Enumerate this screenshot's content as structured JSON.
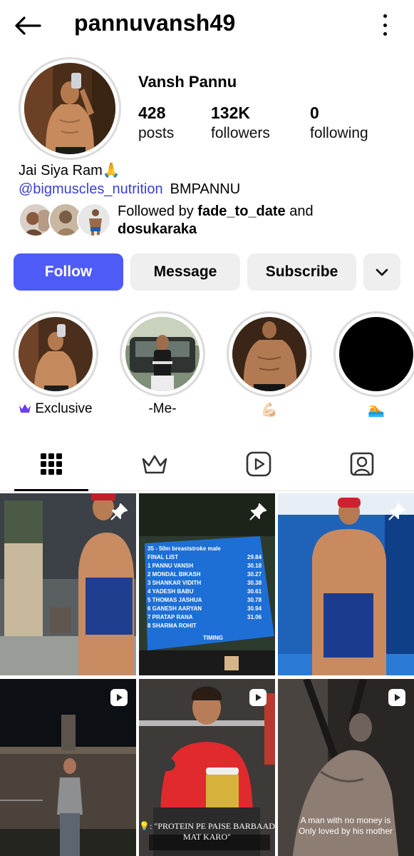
{
  "header": {
    "username": "pannuvansh49",
    "back_icon": "arrow-left-icon",
    "menu_icon": "more-vertical-icon"
  },
  "profile": {
    "full_name": "Vansh Pannu",
    "stats": [
      {
        "value": "428",
        "label": "posts"
      },
      {
        "value": "132K",
        "label": "followers"
      },
      {
        "value": "0",
        "label": "following"
      }
    ],
    "bio_line1": "Jai Siya Ram🙏",
    "mention": "@bigmuscles_nutrition",
    "mention_tail": "BMPANNU",
    "followed_by_prefix": "Followed by ",
    "followed_user1": "fade_to_date",
    "followed_mid": " and",
    "followed_user2": "dosukaraka"
  },
  "actions": {
    "follow": "Follow",
    "message": "Message",
    "subscribe": "Subscribe",
    "more_icon": "chevron-down-icon"
  },
  "highlights": [
    {
      "label": "Exclusive",
      "icon": "crown-icon"
    },
    {
      "label": "-Me-"
    },
    {
      "label": "💪🏻"
    },
    {
      "label": "🏊"
    }
  ],
  "tabs": [
    {
      "name": "posts-grid",
      "icon": "grid-icon",
      "active": true
    },
    {
      "name": "subscriptions",
      "icon": "crown-icon"
    },
    {
      "name": "reels",
      "icon": "reels-icon"
    },
    {
      "name": "tagged",
      "icon": "tagged-user-icon"
    }
  ],
  "posts": [
    {
      "badge": "pin-icon"
    },
    {
      "badge": "pin-icon"
    },
    {
      "badge": "pin-icon"
    },
    {
      "badge": "reel-icon"
    },
    {
      "badge": "reel-icon",
      "caption": "💡: \"PROTEIN PE PAISE BARBAAD MAT KARO\""
    },
    {
      "badge": "reel-icon",
      "caption": "A man with no money is Only loved by his mother"
    }
  ],
  "scoreboard": {
    "lines": [
      "35 - 50m breaststroke male",
      "FINAL LIST",
      "1 PANNU VANSH",
      "2 MONDAL BIKASH",
      "3 SHANKAR VIDITH",
      "4 YADESH BABU",
      "5 THOMAS JASHUA",
      "6 GANESH AARYAN",
      "7 PRATAP RANA",
      "8 SHARMA ROHIT"
    ],
    "times": [
      "29.84",
      "30.18",
      "30.27",
      "30.38",
      "30.61",
      "30.78",
      "30.94",
      "31.06"
    ],
    "timing_label": "TIMING"
  },
  "colors": {
    "follow_blue": "#4e5bf6",
    "mention_blue": "#3a3fd6",
    "button_grey": "#efefef"
  }
}
